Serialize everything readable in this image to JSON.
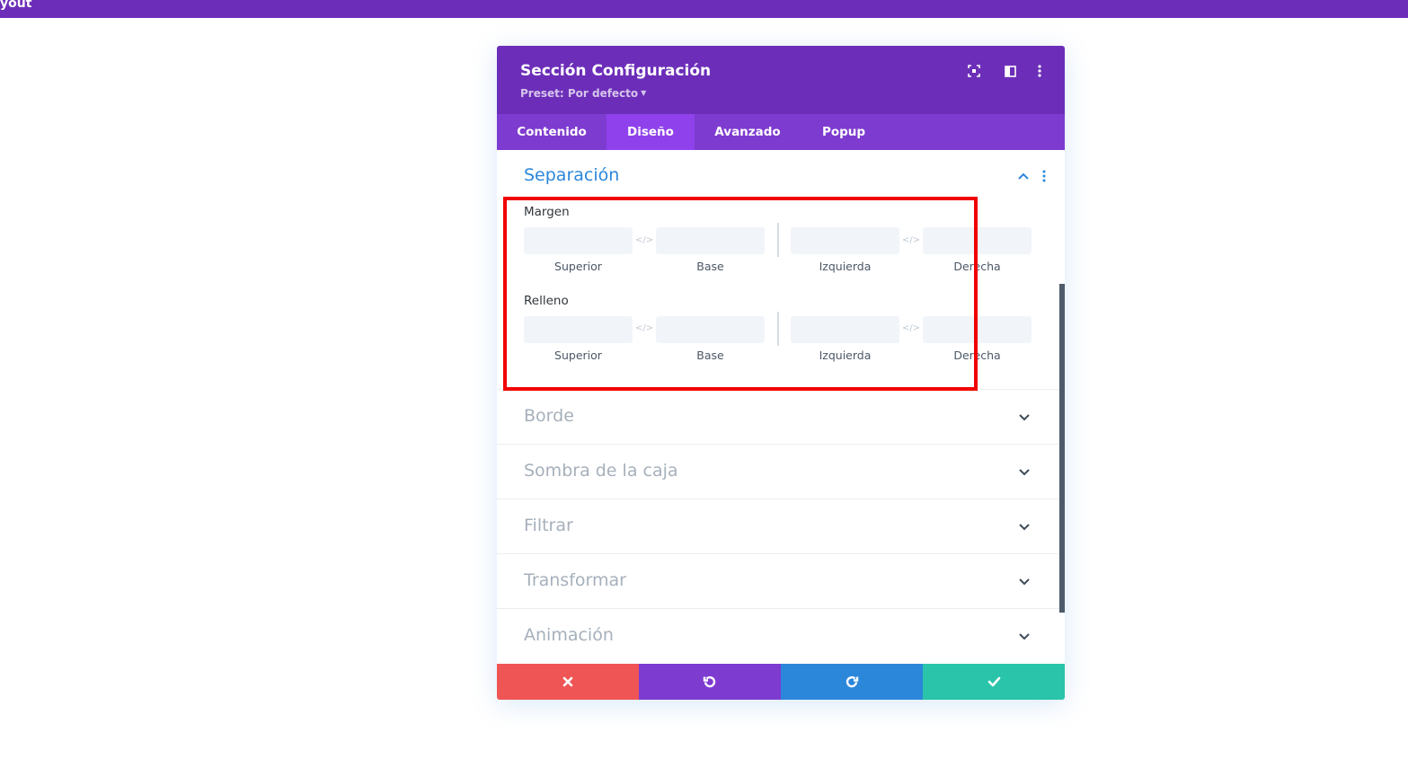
{
  "topbar": {
    "text": "ayout"
  },
  "modal": {
    "title": "Sección Configuración",
    "preset": "Preset: Por defecto",
    "header_icons": [
      "focus-icon",
      "columns-icon",
      "more-vertical-icon"
    ],
    "tabs": [
      {
        "label": "Contenido",
        "active": false
      },
      {
        "label": "Diseño",
        "active": true
      },
      {
        "label": "Avanzado",
        "active": false
      },
      {
        "label": "Popup",
        "active": false
      }
    ],
    "spacing": {
      "title": "Separación",
      "margin": {
        "label": "Margen",
        "fields": [
          {
            "label": "Superior",
            "value": ""
          },
          {
            "label": "Base",
            "value": ""
          },
          {
            "label": "Izquierda",
            "value": ""
          },
          {
            "label": "Derecha",
            "value": ""
          }
        ]
      },
      "padding": {
        "label": "Relleno",
        "fields": [
          {
            "label": "Superior",
            "value": ""
          },
          {
            "label": "Base",
            "value": ""
          },
          {
            "label": "Izquierda",
            "value": ""
          },
          {
            "label": "Derecha",
            "value": ""
          }
        ]
      }
    },
    "collapsed_sections": [
      "Borde",
      "Sombra de la caja",
      "Filtrar",
      "Transformar",
      "Animación"
    ],
    "footer": {
      "buttons": [
        {
          "icon": "close-icon",
          "color": "#ef5555"
        },
        {
          "icon": "undo-icon",
          "color": "#7e3bd0"
        },
        {
          "icon": "redo-icon",
          "color": "#2b87da"
        },
        {
          "icon": "check-icon",
          "color": "#29c4a9"
        }
      ]
    }
  },
  "colors": {
    "header": "#6c2eb9",
    "tabs": "#7e3bd0",
    "tab_active": "#8f42ec",
    "accent": "#2b87da",
    "highlight": "#f00000"
  }
}
